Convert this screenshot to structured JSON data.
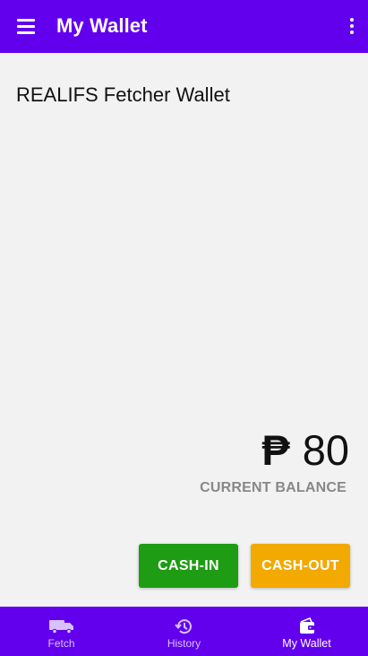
{
  "appbar": {
    "title": "My Wallet",
    "menu_icon": "hamburger-menu-icon",
    "overflow_icon": "more-vert-icon",
    "color": "#6200ee"
  },
  "wallet": {
    "name": "REALIFS Fetcher Wallet",
    "currency_symbol": "₱",
    "balance": "80",
    "balance_label": "CURRENT BALANCE"
  },
  "actions": {
    "cash_in": {
      "label": "CASH-IN",
      "color": "#1e9c13"
    },
    "cash_out": {
      "label": "CASH-OUT",
      "color": "#f2a900"
    }
  },
  "bottom_nav": {
    "items": [
      {
        "label": "Fetch",
        "icon": "truck-icon",
        "active": false
      },
      {
        "label": "History",
        "icon": "history-icon",
        "active": false
      },
      {
        "label": "My Wallet",
        "icon": "wallet-icon",
        "active": true
      }
    ]
  }
}
